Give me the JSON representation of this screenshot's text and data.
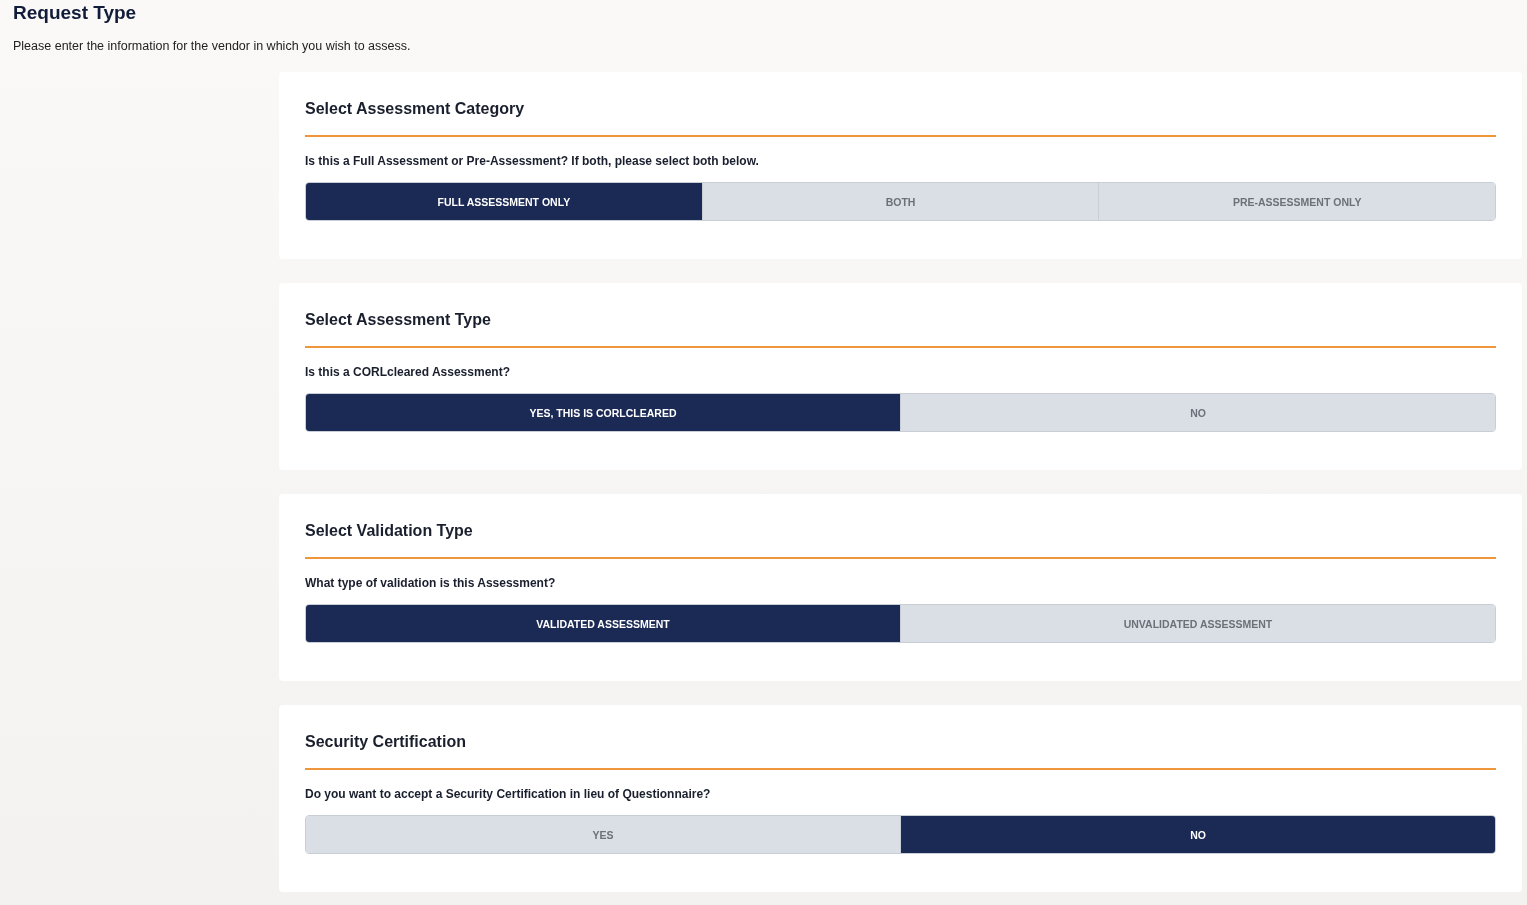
{
  "page": {
    "title": "Request Type",
    "subtitle": "Please enter the information for the vendor in which you wish to assess."
  },
  "sections": [
    {
      "heading": "Select Assessment Category",
      "question": "Is this a Full Assessment or Pre-Assessment? If both, please select both below.",
      "options": [
        {
          "label": "FULL ASSESSMENT ONLY",
          "selected": true
        },
        {
          "label": "BOTH",
          "selected": false
        },
        {
          "label": "PRE-ASSESSMENT ONLY",
          "selected": false
        }
      ]
    },
    {
      "heading": "Select Assessment Type",
      "question": "Is this a CORLcleared Assessment?",
      "options": [
        {
          "label": "YES, THIS IS CORLCLEARED",
          "selected": true
        },
        {
          "label": "NO",
          "selected": false
        }
      ]
    },
    {
      "heading": "Select Validation Type",
      "question": "What type of validation is this Assessment?",
      "options": [
        {
          "label": "VALIDATED ASSESSMENT",
          "selected": true
        },
        {
          "label": "UNVALIDATED ASSESSMENT",
          "selected": false
        }
      ]
    },
    {
      "heading": "Security Certification",
      "question": "Do you want to accept a Security Certification in lieu of Questionnaire?",
      "options": [
        {
          "label": "YES",
          "selected": false
        },
        {
          "label": "NO",
          "selected": true
        }
      ]
    }
  ]
}
